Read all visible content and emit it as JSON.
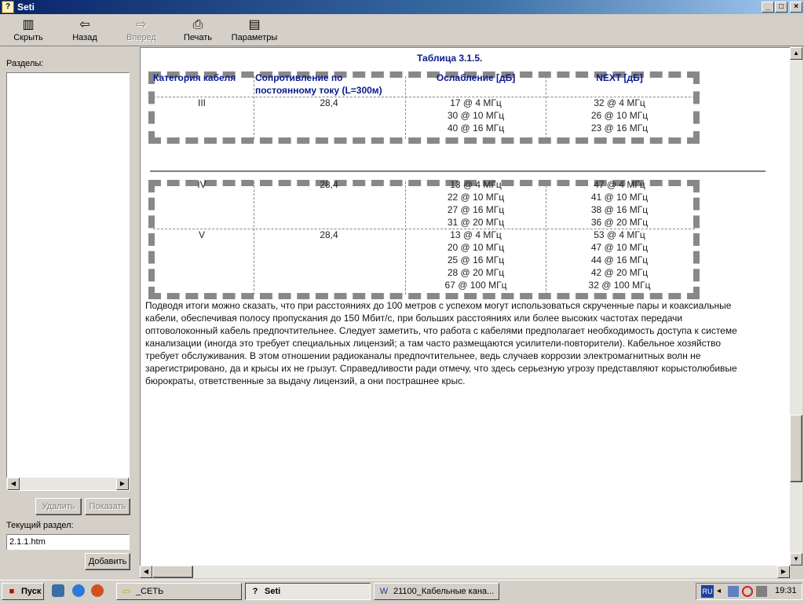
{
  "window": {
    "title": "Seti",
    "controls": {
      "minimize": "_",
      "maximize": "□",
      "close": "×"
    }
  },
  "toolbar": {
    "hide_label": "Скрыть",
    "back_label": "Назад",
    "forward_label": "Вперед",
    "print_label": "Печать",
    "options_label": "Параметры"
  },
  "sidebar": {
    "sections_label": "Разделы:",
    "delete_label": "Удалить",
    "show_label": "Показать",
    "current_section_label": "Текущий раздел:",
    "current_section_value": "2.1.1.htm",
    "add_label": "Добавить"
  },
  "content": {
    "table_caption": "Таблица 3.1.5.",
    "headers": [
      "Категория кабеля",
      "Сопротивление по постоянному току (L=300м)",
      "Ослабление [дБ]",
      "NEXT [дБ]"
    ],
    "rows": [
      {
        "category": "III",
        "resistance": "28,4",
        "attenuation": [
          "17 @ 4 МГц",
          "30 @ 10 МГц",
          "40 @ 16 МГц"
        ],
        "next": [
          "32 @ 4 МГц",
          "26 @ 10 МГц",
          "23 @ 16 МГц"
        ]
      },
      {
        "category": "IV",
        "resistance": "28,4",
        "attenuation": [
          "13 @ 4 МГц",
          "22 @ 10 МГц",
          "27 @ 16 МГц",
          "31 @ 20 МГц"
        ],
        "next": [
          "47 @ 4 МГц",
          "41 @ 10 МГц",
          "38 @ 16 МГц",
          "36 @ 20 МГц"
        ]
      },
      {
        "category": "V",
        "resistance": "28,4",
        "attenuation": [
          "13 @ 4 МГц",
          "20 @ 10 МГц",
          "25 @ 16 МГц",
          "28 @ 20 МГц",
          "67 @ 100 МГц"
        ],
        "next": [
          "53 @ 4 МГц",
          "47 @ 10 МГц",
          "44 @ 16 МГц",
          "42 @ 20 МГц",
          "32 @ 100 МГц"
        ]
      }
    ],
    "paragraph": "Подводя итоги можно сказать, что при расстояниях до 100 метров с успехом могут использоваться скрученные пары и коаксиальные кабели, обеспечивая полосу пропускания до 150 Мбит/с, при больших расстояниях или более высоких частотах передачи оптоволоконный кабель предпочтительнее. Следует заметить, что работа с кабелями предполагает необходимость доступа к системе канализации (иногда это требует специальных лицензий; а там часто размещаются усилители-повторители). Кабельное хозяйство требует обслуживания. В этом отношении радиоканалы предпочтительнее, ведь случаев коррозии электромагнитных волн не зарегистрировано, да и крысы их не грызут. Справедливости ради отмечу, что здесь серьезную угрозу представляют корыстолюбивые бюрократы, ответственные за выдачу лицензий, а они пострашнее крыс."
  },
  "taskbar": {
    "start_label": "Пуск",
    "tasks": [
      "_СЕТЬ",
      "Seti",
      "21100_Кабельные кана..."
    ],
    "lang": "RU",
    "clock": "19:31"
  }
}
